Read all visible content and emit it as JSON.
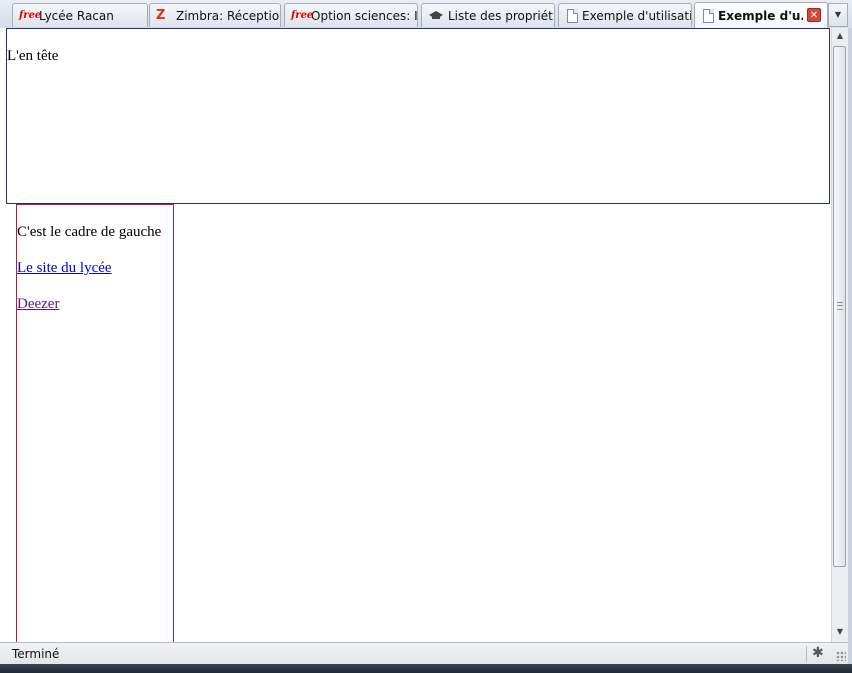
{
  "tabs": [
    {
      "label": "Lycée Racan",
      "icon": "free-favicon",
      "active": false
    },
    {
      "label": "Zimbra: Réceptio...",
      "icon": "zimbra-favicon",
      "active": false
    },
    {
      "label": "Option sciences: I...",
      "icon": "free-favicon",
      "active": false
    },
    {
      "label": "Liste des propriét...",
      "icon": "graduation-cap-favicon",
      "active": false
    },
    {
      "label": "Exemple d'utilisati...",
      "icon": "page-favicon",
      "active": false
    },
    {
      "label": "Exemple d'u...",
      "icon": "page-favicon",
      "active": true
    }
  ],
  "favicon_text": {
    "free": "free",
    "zimbra": "Z"
  },
  "tab_close_glyph": "✕",
  "tab_list_glyph": "▼",
  "page": {
    "header_text": "L'en tête",
    "left_frame": {
      "text": "C'est le cadre de gauche",
      "links": [
        {
          "label": "Le site du lycée",
          "visited": false
        },
        {
          "label": "Deezer",
          "visited": true
        }
      ]
    }
  },
  "scrollbar": {
    "up_glyph": "▲",
    "down_glyph": "▼"
  },
  "status": {
    "text": "Terminé",
    "addon_icon": "bug-icon",
    "addon_glyph": "✱"
  },
  "colors": {
    "header_frame_border": "#2a2a8a",
    "left_frame_border": "#b0203a",
    "link": "#0000ee",
    "visited_link": "#551a8b"
  }
}
